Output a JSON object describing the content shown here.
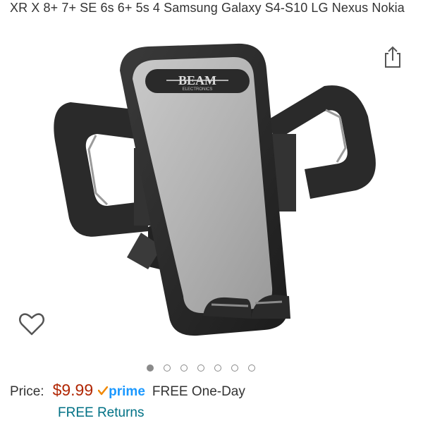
{
  "product": {
    "title": "XR X 8+ 7+ SE 6s 6+ 5s 4 Samsung Galaxy S4-S10 LG Nexus Nokia",
    "brand_logo_text": "BEAM",
    "brand_logo_subtext": "ELECTRONICS",
    "image_icon": "car-vent-phone-mount-image"
  },
  "actions": {
    "share_icon": "share-icon",
    "wishlist_icon": "heart-outline-icon"
  },
  "carousel": {
    "count": 7,
    "active_index": 0
  },
  "pricing": {
    "label": "Price:",
    "value": "$9.99",
    "prime_check": "✓",
    "prime_text": "prime",
    "delivery": "FREE One-Day",
    "returns": "FREE Returns"
  },
  "colors": {
    "price": "#b12704",
    "prime": "#1a98ff",
    "link": "#007185",
    "text": "#333333"
  }
}
